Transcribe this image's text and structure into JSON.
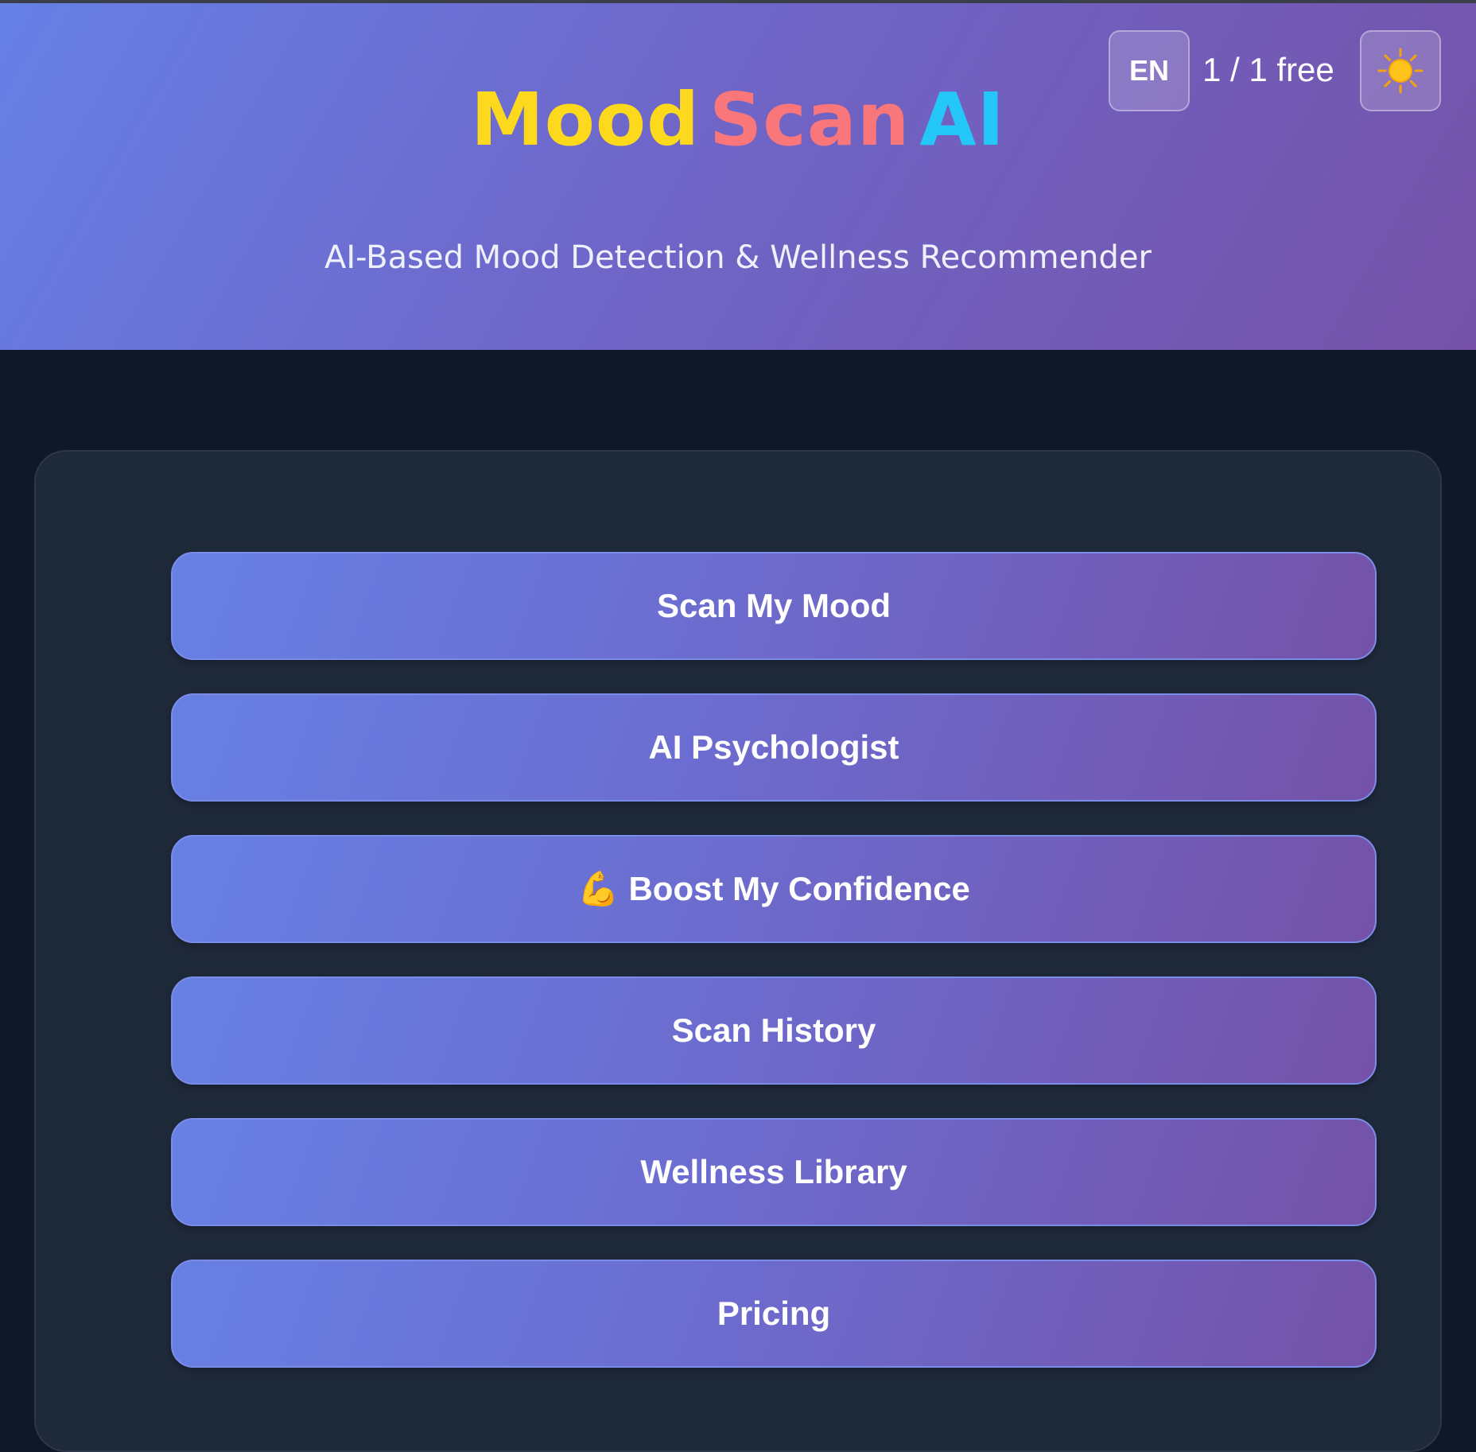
{
  "header": {
    "title_words": [
      "Mood",
      "Scan",
      "AI"
    ],
    "subtitle": "AI-Based Mood Detection & Wellness Recommender",
    "language": "EN",
    "usage": "1 / 1 free",
    "theme_icon": "sun-icon"
  },
  "menu": {
    "items": [
      {
        "label": "Scan My Mood",
        "icon": ""
      },
      {
        "label": "AI Psychologist",
        "icon": ""
      },
      {
        "label": "Boost My Confidence",
        "icon": "💪"
      },
      {
        "label": "Scan History",
        "icon": ""
      },
      {
        "label": "Wellness Library",
        "icon": ""
      },
      {
        "label": "Pricing",
        "icon": ""
      }
    ]
  },
  "colors": {
    "title_mood": "#fcd91c",
    "title_scan": "#f9767a",
    "title_ai": "#24c7f7",
    "background": "#0f1829",
    "card": "#1e293a"
  }
}
